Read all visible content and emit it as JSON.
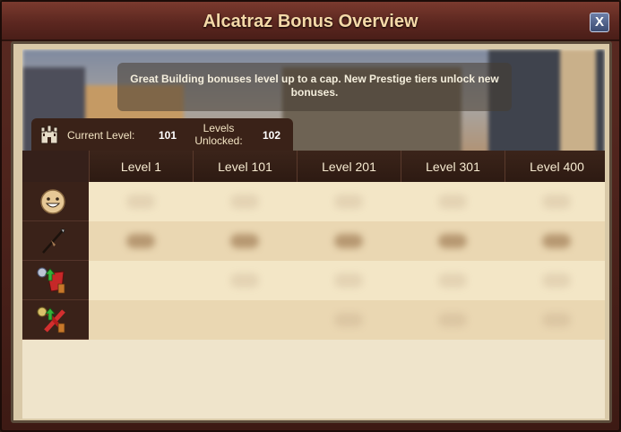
{
  "window": {
    "title": "Alcatraz Bonus Overview",
    "close_label": "X"
  },
  "banner": {
    "text": "Great Building bonuses level up to a cap. New Prestige tiers unlock new bonuses."
  },
  "levels": {
    "current_label": "Current Level:",
    "current_value": "101",
    "unlocked_label_line1": "Levels",
    "unlocked_label_line2": "Unlocked:",
    "unlocked_value": "102"
  },
  "table": {
    "columns": [
      "Level 1",
      "Level 101",
      "Level 201",
      "Level 301",
      "Level 400"
    ],
    "rows": [
      {
        "icon": "happiness-icon"
      },
      {
        "icon": "spear-icon"
      },
      {
        "icon": "attack-boost-icon"
      },
      {
        "icon": "defense-boost-icon"
      }
    ]
  },
  "colors": {
    "title_text": "#f5d9a8",
    "header_bg": "#3b241a",
    "cell_bg": "#f3e6c6",
    "close_button": "#5a6c94"
  }
}
